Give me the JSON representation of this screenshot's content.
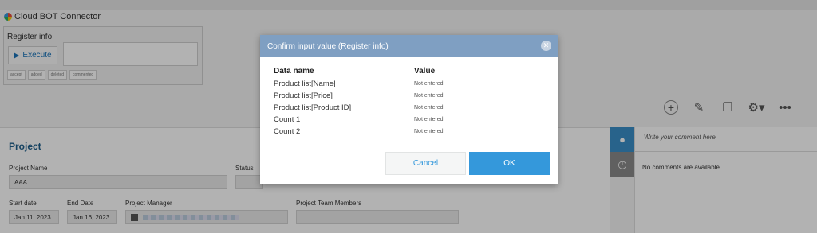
{
  "plugin": {
    "title": "Cloud BOT Connector"
  },
  "register": {
    "label": "Register info",
    "execute_label": "Execute",
    "tags": [
      "accept",
      "added",
      "deleted",
      "commented"
    ]
  },
  "toolbar": {
    "icons": [
      "plus-icon",
      "edit-icon",
      "copy-icon",
      "gear-icon",
      "more-icon"
    ]
  },
  "record": {
    "title": "Project",
    "fields": {
      "project_name_label": "Project Name",
      "project_name_value": "AAA",
      "status_label": "Status",
      "start_date_label": "Start date",
      "start_date_value": "Jan 11, 2023",
      "end_date_label": "End Date",
      "end_date_value": "Jan 16, 2023",
      "pm_label": "Project Manager",
      "team_label": "Project Team Members"
    }
  },
  "comments": {
    "placeholder": "Write your comment here.",
    "empty": "No comments are available."
  },
  "modal": {
    "title": "Confirm input value (Register info)",
    "col_data_name": "Data name",
    "col_value": "Value",
    "rows": [
      {
        "name": "Product list[Name]",
        "value": "Not entered"
      },
      {
        "name": "Product list[Price]",
        "value": "Not entered"
      },
      {
        "name": "Product list[Product ID]",
        "value": "Not entered"
      },
      {
        "name": "Count 1",
        "value": "Not entered"
      },
      {
        "name": "Count 2",
        "value": "Not entered"
      }
    ],
    "cancel_label": "Cancel",
    "ok_label": "OK"
  },
  "colors": {
    "modal_header": "#7f9fc2",
    "primary": "#3498db",
    "record_title": "#1f5f8b"
  }
}
